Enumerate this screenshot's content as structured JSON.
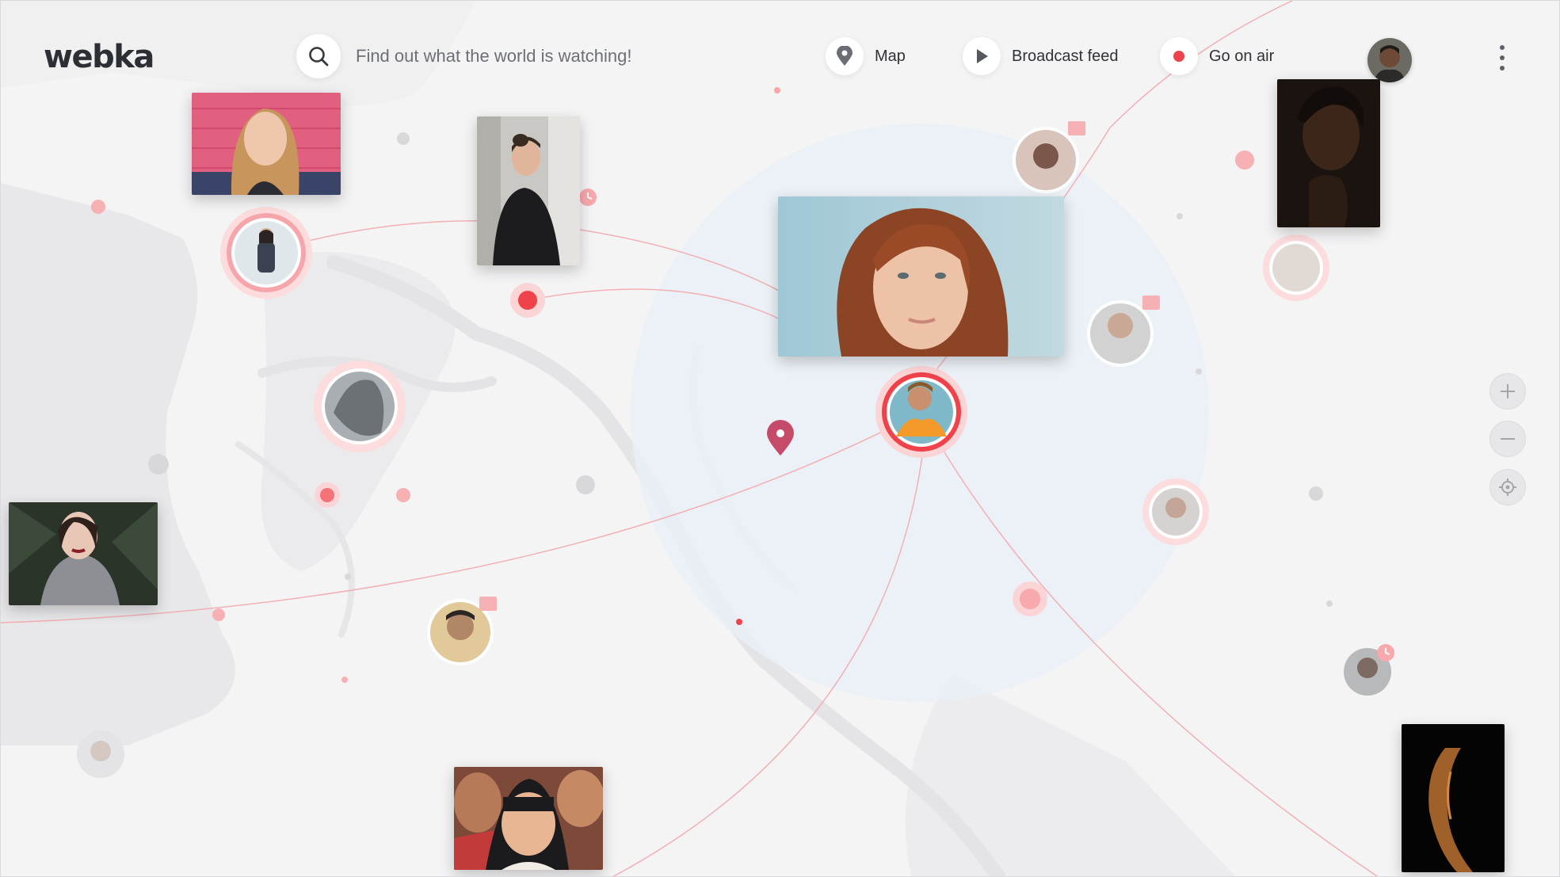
{
  "app": {
    "logo": "webka"
  },
  "search": {
    "placeholder": "Find out what the world is watching!"
  },
  "nav": [
    {
      "label": "Map",
      "icon": "map-pin-icon"
    },
    {
      "label": "Broadcast feed",
      "icon": "play-icon"
    },
    {
      "label": "Go on air",
      "icon": "live-dot-icon"
    }
  ],
  "user": {
    "avatar": "user-avatar"
  },
  "map_controls": [
    "zoom-in-icon",
    "zoom-out-icon",
    "locate-icon"
  ],
  "colors": {
    "accent": "#f0424a",
    "accent_light": "#f7a9ad",
    "map_bg": "#f4f4f5",
    "land": "#e9e9eb",
    "focus_circle": "#e9f0f6",
    "pin": "#c64a6a"
  }
}
